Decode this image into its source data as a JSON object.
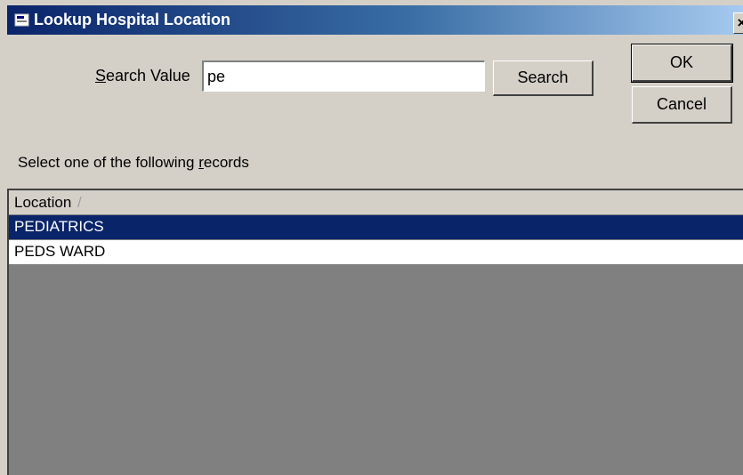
{
  "window": {
    "title": "Lookup Hospital Location",
    "close_label": "×",
    "title_icon": "window-icon"
  },
  "search": {
    "label": "Search Value",
    "value": "pe",
    "button_label": "Search"
  },
  "actions": {
    "ok_label": "OK",
    "cancel_label": "Cancel"
  },
  "records": {
    "instruction": "Select one of the following records",
    "column_header": "Location",
    "sort_indicator": "/",
    "rows": [
      {
        "label": "PEDIATRICS",
        "selected": true
      },
      {
        "label": "PEDS WARD",
        "selected": false
      }
    ]
  },
  "colors": {
    "selection": "#0a246a",
    "title_gradient_start": "#0a246a",
    "title_gradient_end": "#a6caf0",
    "dialog_face": "#d4d0c8",
    "grid_background": "#808080"
  }
}
